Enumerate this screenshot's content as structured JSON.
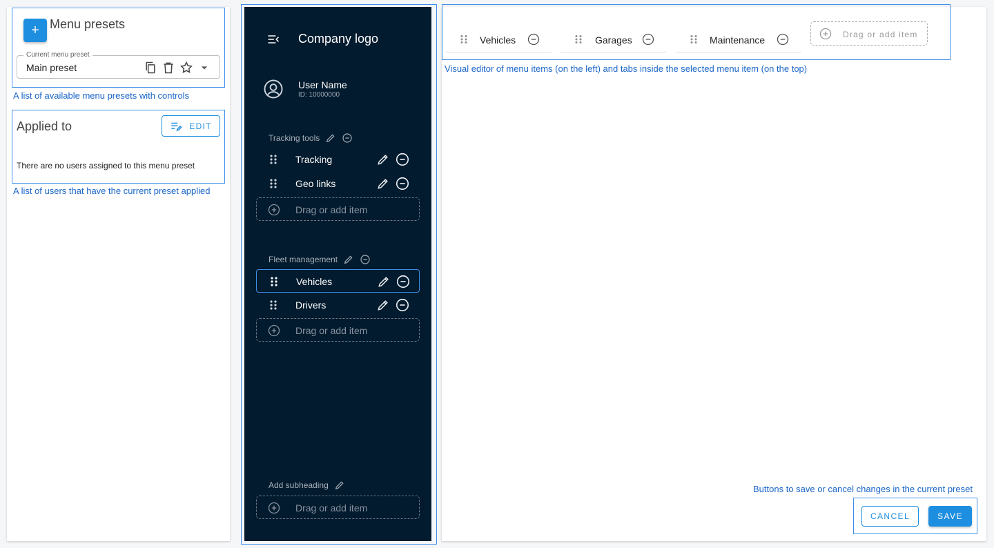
{
  "presets_panel": {
    "add_button_label": "+",
    "title": "Menu presets",
    "current_preset_legend": "Current menu preset",
    "current_preset_value": "Main preset",
    "field_icons": [
      "copy-icon",
      "trash-icon",
      "star-icon",
      "caret-down-icon"
    ]
  },
  "applied_panel": {
    "title": "Applied to",
    "edit_label": "EDIT",
    "empty_message": "There are no users assigned to this menu preset"
  },
  "sidebar": {
    "company_logo": "Company logo",
    "user_name": "User Name",
    "user_id": "ID: 10000000",
    "groups": [
      {
        "subheading": "Tracking tools",
        "items": [
          "Tracking",
          "Geo links"
        ]
      },
      {
        "subheading": "Fleet management",
        "items": [
          "Vehicles",
          "Drivers"
        ],
        "selected": "Vehicles"
      }
    ],
    "add_subheading": "Add subheading",
    "drop_label": "Drag or add item"
  },
  "tabs": {
    "items": [
      "Vehicles",
      "Garages",
      "Maintenance"
    ],
    "drop_label": "Drag or add item"
  },
  "actions": {
    "cancel_label": "CANCEL",
    "save_label": "SAVE"
  },
  "annotations": {
    "presets": "A list of available menu presets with controls",
    "users": "A list of users that have the current preset applied",
    "editor": "Visual editor of menu items (on the left) and tabs inside the selected menu item (on the top)",
    "buttons": "Buttons to save or cancel changes in the current preset"
  },
  "colors": {
    "accent": "#1e8fe0",
    "sidebar_bg": "#031b2e",
    "annotation": "#1a66c9"
  }
}
